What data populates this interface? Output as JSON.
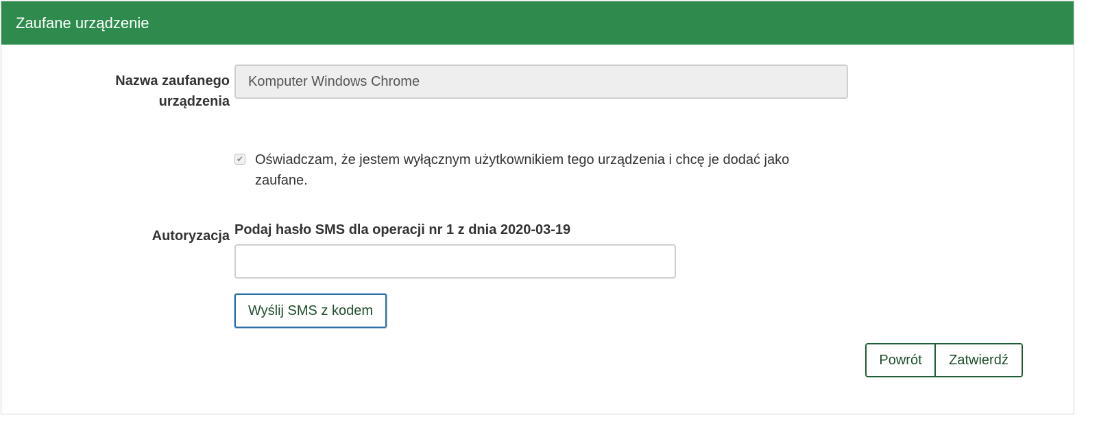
{
  "header": {
    "title": "Zaufane urządzenie"
  },
  "form": {
    "device_name_label": "Nazwa zaufanego urządzenia",
    "device_name_value": "Komputer Windows Chrome",
    "declaration_checked": true,
    "declaration_text": "Oświadczam, że jestem wyłącznym użytkownikiem tego urządzenia i chcę je dodać jako zaufane.",
    "authorization_label": "Autoryzacja",
    "sms_prompt": "Podaj hasło SMS dla operacji nr 1 z dnia 2020-03-19",
    "sms_code_value": "",
    "send_sms_label": "Wyślij SMS z kodem"
  },
  "actions": {
    "back_label": "Powrót",
    "confirm_label": "Zatwierdź"
  },
  "colors": {
    "header_bg": "#2e8b4d",
    "button_border": "#1e5c35",
    "focus_border": "#2f6ea6"
  }
}
